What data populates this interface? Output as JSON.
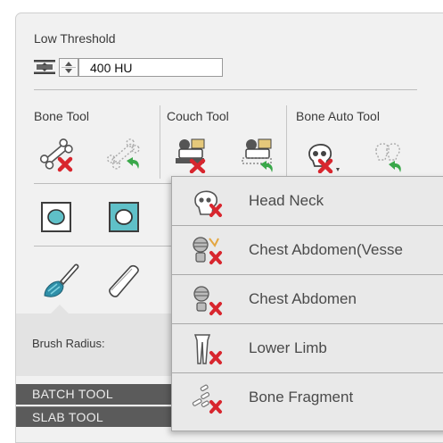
{
  "low_threshold": {
    "label": "Low Threshold",
    "value": "400 HU"
  },
  "tool_groups": {
    "bone_tool": "Bone Tool",
    "couch_tool": "Couch Tool",
    "bone_auto_tool": "Bone Auto Tool"
  },
  "brush": {
    "radius_label": "Brush Radius:"
  },
  "sections": {
    "batch_tool": "BATCH TOOL",
    "slab_tool": "SLAB TOOL"
  },
  "bone_auto_menu": {
    "items": [
      {
        "label": "Head Neck",
        "icon": "head-neck-icon"
      },
      {
        "label": "Chest Abdomen(Vesse",
        "icon": "chest-abdomen-vessel-icon"
      },
      {
        "label": "Chest Abdomen",
        "icon": "chest-abdomen-icon"
      },
      {
        "label": "Lower Limb",
        "icon": "lower-limb-icon"
      },
      {
        "label": "Bone Fragment",
        "icon": "bone-fragment-icon"
      }
    ]
  },
  "colors": {
    "remove_red": "#d8262e",
    "undo_green": "#3aa84a",
    "accent_teal": "#5fc0c8",
    "section_bar": "#5b5b5b"
  }
}
